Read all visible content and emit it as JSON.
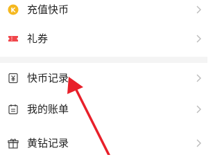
{
  "menu": {
    "items": [
      {
        "label": "充值快币",
        "icon": "coin-icon"
      },
      {
        "label": "礼券",
        "icon": "coupon-ticket-icon"
      },
      {
        "label": "快币记录",
        "icon": "currency-record-icon"
      },
      {
        "label": "我的账单",
        "icon": "bill-icon"
      },
      {
        "label": "黄钻记录",
        "icon": "gift-box-icon"
      }
    ]
  },
  "coin_icon_text": "K",
  "colors": {
    "coin": "#f5b81f",
    "coupon": "#f0464b",
    "line_icon": "#444444",
    "chevron": "#bbbbbb",
    "annotation_arrow": "#e8202a",
    "divider": "#f4f4f4"
  },
  "annotation": {
    "type": "arrow",
    "points_to": "快币记录"
  }
}
